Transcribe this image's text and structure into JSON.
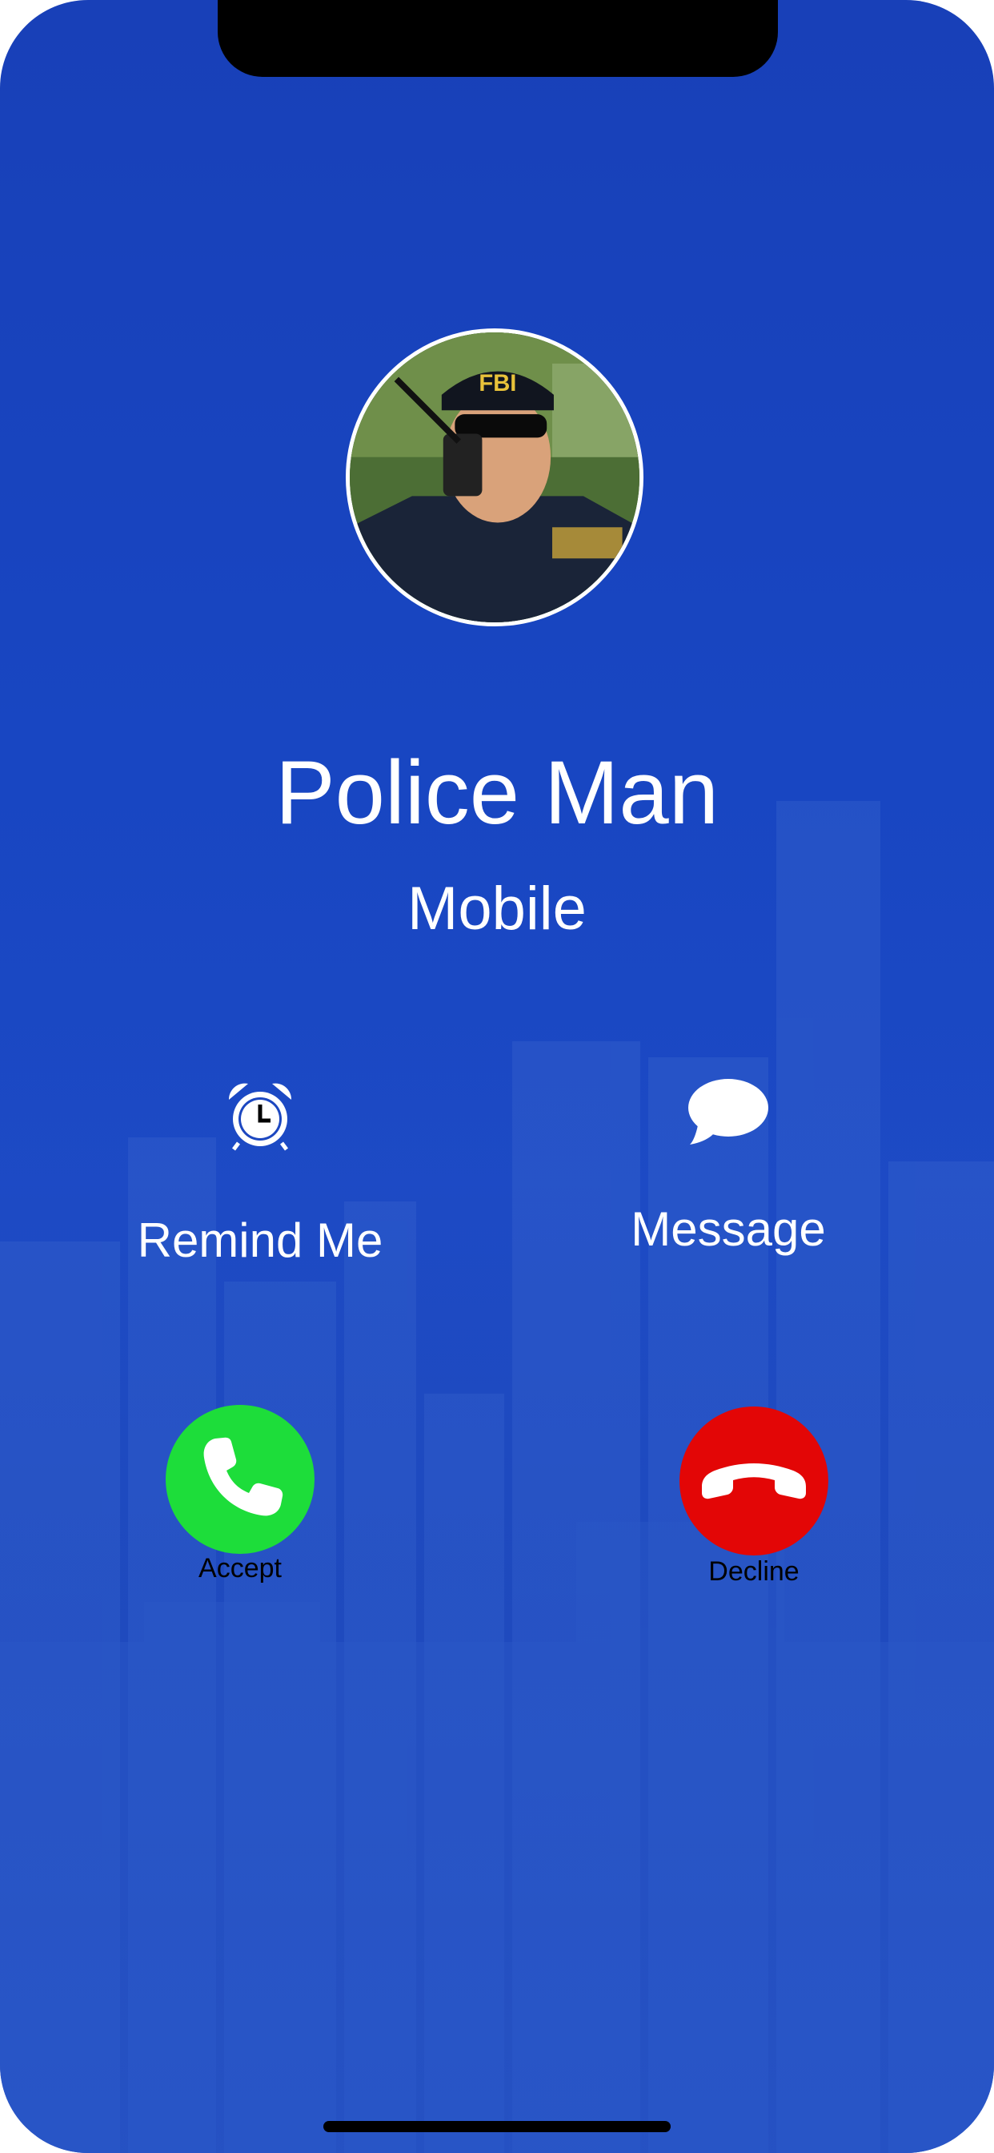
{
  "caller": {
    "name": "Police Man",
    "subtitle": "Mobile",
    "avatar": "caller-photo"
  },
  "actions": {
    "remind": {
      "label": "Remind Me",
      "icon": "alarm-clock-icon"
    },
    "message": {
      "label": "Message",
      "icon": "speech-bubble-icon"
    }
  },
  "call_buttons": {
    "accept": {
      "label": "Accept",
      "icon": "phone-icon",
      "color": "#1ddd3a"
    },
    "decline": {
      "label": "Decline",
      "icon": "phone-hangup-icon",
      "color": "#e30606"
    }
  },
  "theme": {
    "background": "#1a44bc",
    "text": "#ffffff"
  }
}
